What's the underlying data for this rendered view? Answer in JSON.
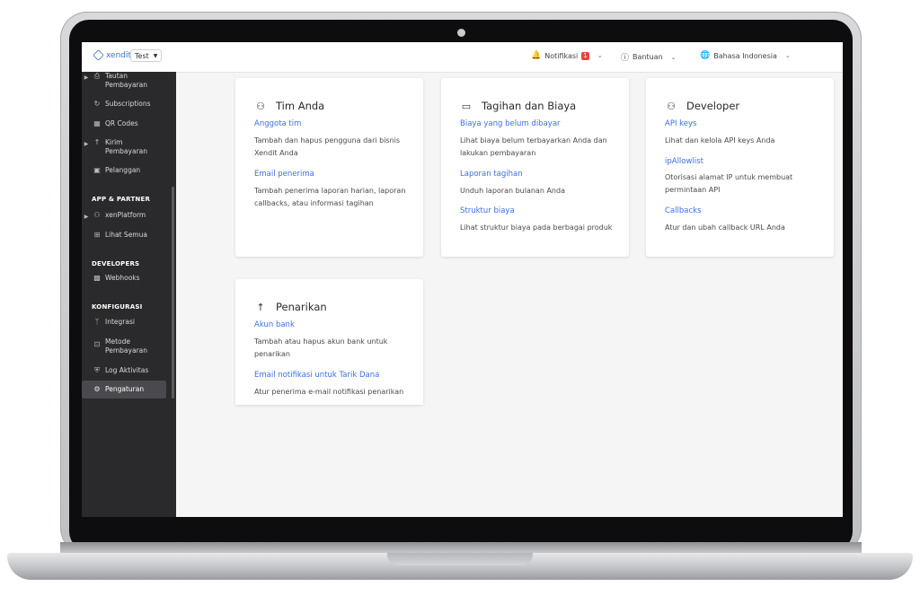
{
  "topbar": {
    "logo_text": "xendit",
    "env_label": "Test",
    "notifications_label": "Notifikasi",
    "notifications_count": "1",
    "help_label": "Bantuan",
    "language_label": "Bahasa Indonesia"
  },
  "sidebar": {
    "items": [
      {
        "label_line1": "Tautan",
        "label_line2": "Pembayaran"
      },
      {
        "label_line1": "Subscriptions"
      },
      {
        "label_line1": "QR Codes"
      },
      {
        "label_line1": "Kirim",
        "label_line2": "Pembayaran"
      },
      {
        "label_line1": "Pelanggan"
      }
    ],
    "section_app": "APP & PARTNER",
    "app_items": [
      {
        "label": "xenPlatform"
      },
      {
        "label": "Lihat Semua"
      }
    ],
    "section_dev": "DEVELOPERS",
    "dev_items": [
      {
        "label": "Webhooks"
      }
    ],
    "section_config": "KONFIGURASI",
    "config_items": [
      {
        "label_line1": "Integrasi"
      },
      {
        "label_line1": "Metode",
        "label_line2": "Pembayaran"
      },
      {
        "label_line1": "Log Aktivitas"
      },
      {
        "label_line1": "Pengaturan"
      }
    ]
  },
  "cards": {
    "team": {
      "title": "Tim Anda",
      "link1": "Anggota tim",
      "desc1": "Tambah dan hapus pengguna dari bisnis Xendit Anda",
      "link2": "Email penerima",
      "desc2": "Tambah penerima laporan harian, laporan callbacks, atau informasi tagihan"
    },
    "billing": {
      "title": "Tagihan dan Biaya",
      "link1": "Biaya yang belum dibayar",
      "desc1": "Lihat biaya belum terbayarkan Anda dan lakukan pembayaran",
      "link2": "Laporan tagihan",
      "desc2": "Unduh laporan bulanan Anda",
      "link3": "Struktur biaya",
      "desc3": "Lihat struktur biaya pada berbagai produk"
    },
    "developer": {
      "title": "Developer",
      "link1": "API keys",
      "desc1": "Lihat dan kelola API keys Anda",
      "link2": "ipAllowlist",
      "desc2": "Otorisasi alamat IP untuk membuat permintaan API",
      "link3": "Callbacks",
      "desc3": "Atur dan ubah callback URL Anda"
    },
    "withdraw": {
      "title": "Penarikan",
      "link1": "Akun bank",
      "desc1": "Tambah atau hapus akun bank untuk penarikan",
      "link2": "Email notifikasi untuk Tarik Dana",
      "desc2": "Atur penerima e-mail notifikasi penarikan"
    }
  },
  "colors": {
    "accent": "#3c6ff0",
    "sidebar_bg": "#2a2a2c",
    "badge": "#e5483c"
  }
}
